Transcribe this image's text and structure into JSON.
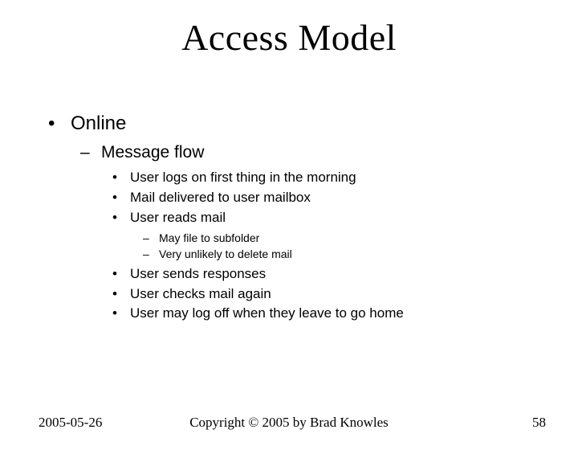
{
  "title": "Access Model",
  "bullets": {
    "l1": "Online",
    "l2": "Message flow",
    "l3a": "User logs on first thing in the morning",
    "l3b": "Mail delivered to user mailbox",
    "l3c": "User reads mail",
    "l4a": "May file to subfolder",
    "l4b": "Very unlikely to delete mail",
    "l3d": "User sends responses",
    "l3e": "User checks mail again",
    "l3f": "User may log off when they leave to go home"
  },
  "footer": {
    "date": "2005-05-26",
    "copyright": "Copyright © 2005 by Brad Knowles",
    "page": "58"
  }
}
